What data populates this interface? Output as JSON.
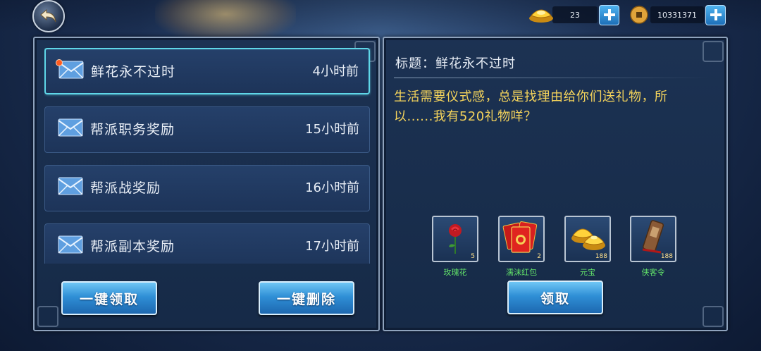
{
  "currencies": {
    "gold_ingot_count": "23",
    "coin_count": "10331371"
  },
  "mail_list": [
    {
      "title": "鲜花永不过时",
      "time": "4小时前",
      "unread": true
    },
    {
      "title": "帮派职务奖励",
      "time": "15小时前",
      "unread": false
    },
    {
      "title": "帮派战奖励",
      "time": "16小时前",
      "unread": false
    },
    {
      "title": "帮派副本奖励",
      "time": "17小时前",
      "unread": false
    }
  ],
  "left_buttons": {
    "claim_all": "一键领取",
    "delete_all": "一键删除"
  },
  "detail": {
    "title": "标题：鲜花永不过时",
    "body_line1": "生活需要仪式感，总是找理由给你们送礼物，所",
    "body_line2": "以......我有520礼物咩？"
  },
  "rewards": [
    {
      "name": "玫瑰花",
      "count": "5",
      "icon": "rose-icon"
    },
    {
      "name": "濡沫红包",
      "count": "2",
      "icon": "red-envelope-icon"
    },
    {
      "name": "元宝",
      "count": "188",
      "icon": "gold-ingot-icon"
    },
    {
      "name": "侠客令",
      "count": "188",
      "icon": "token-icon"
    }
  ],
  "claim_button": "领取",
  "colors": {
    "accent_cyan": "#5fd7e8",
    "body_text_yellow": "#f4d35b",
    "reward_name_green": "#63e56a",
    "unread_dot": "#ff5a1f"
  }
}
